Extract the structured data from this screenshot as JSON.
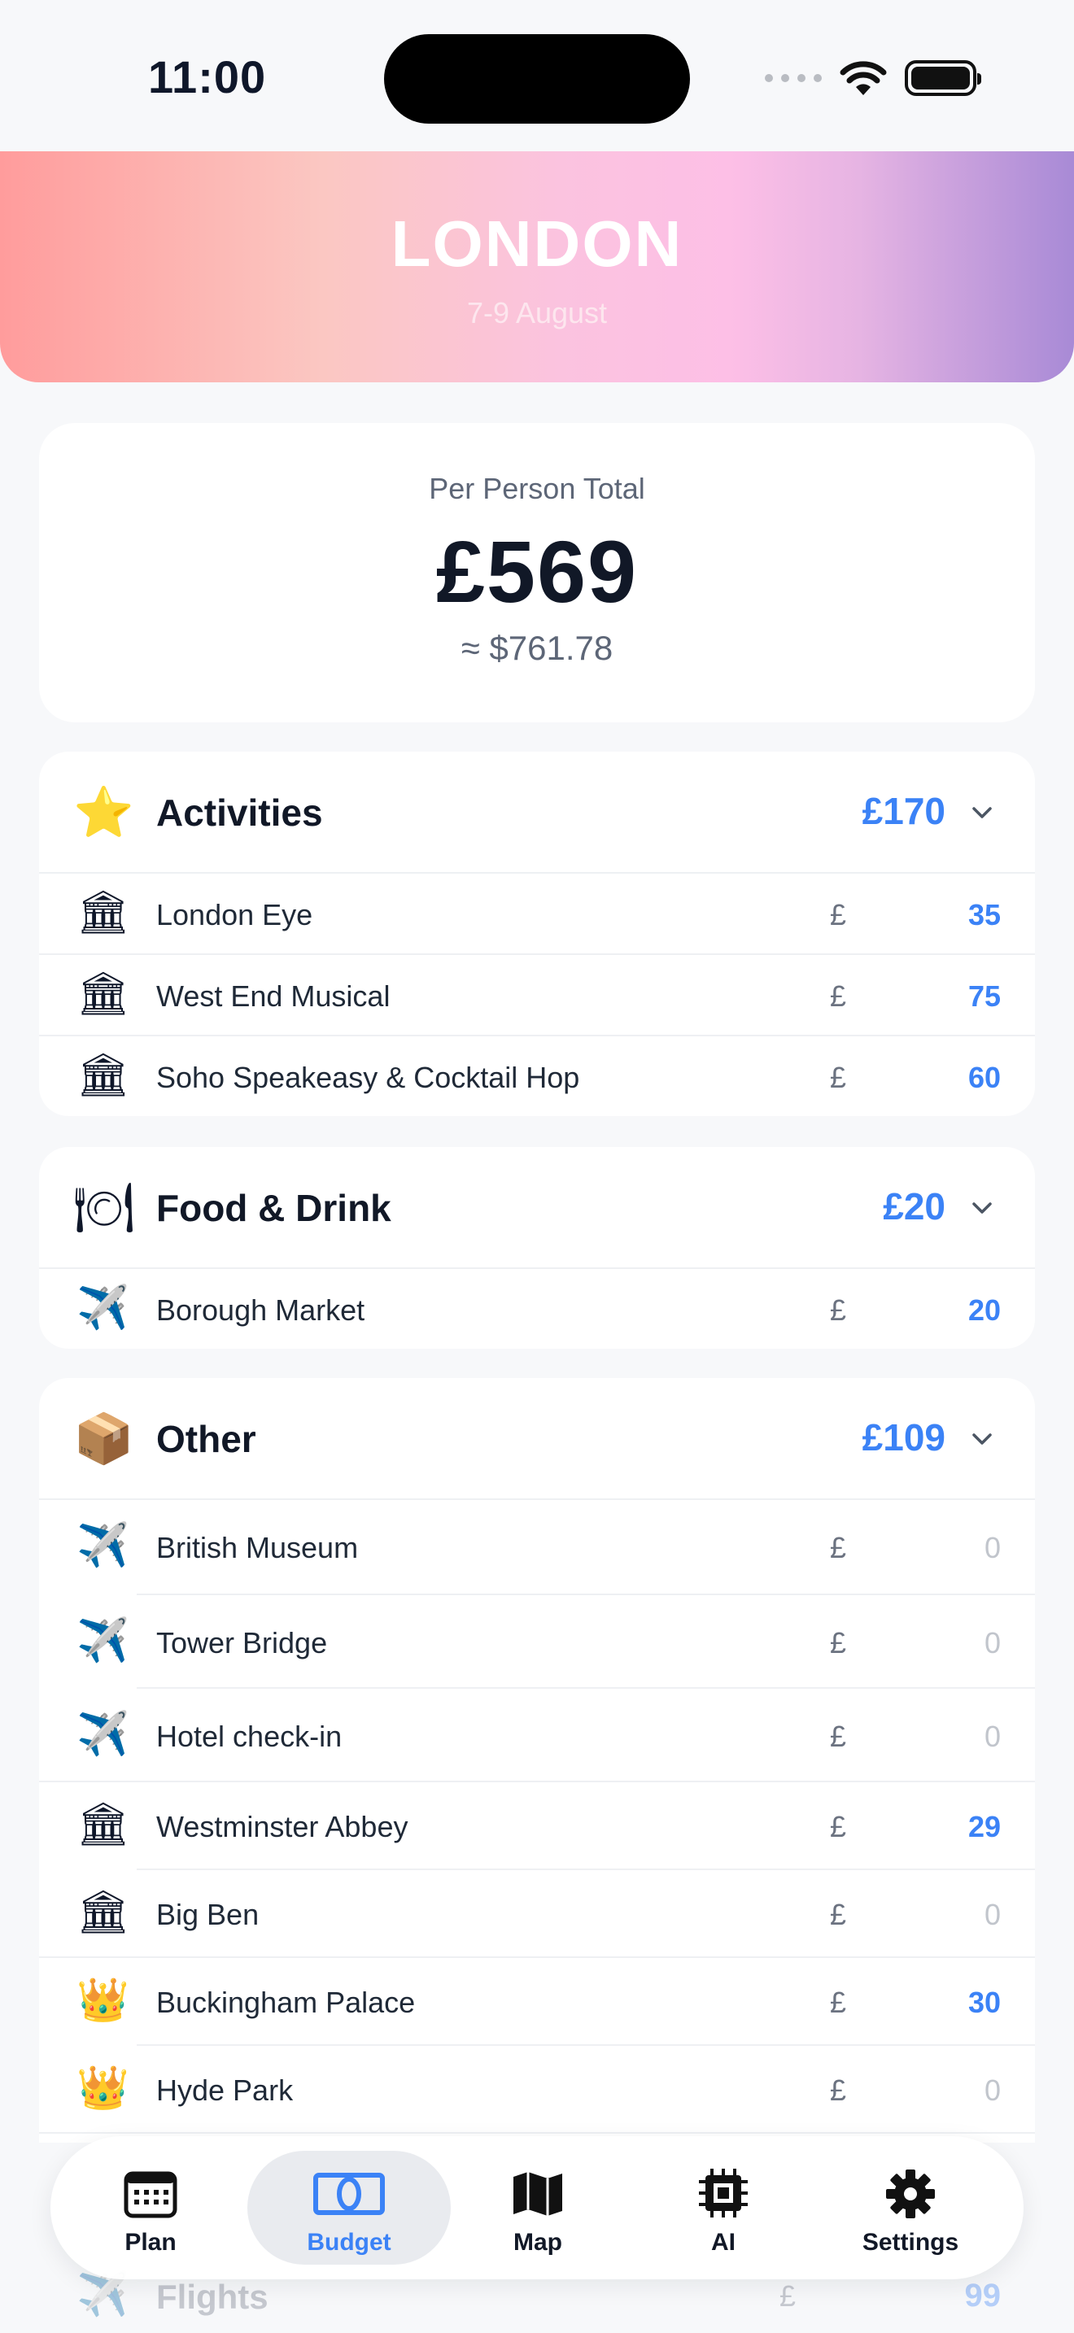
{
  "status": {
    "time": "11:00"
  },
  "header": {
    "title": "LONDON",
    "dates": "7-9 August"
  },
  "summary": {
    "label": "Per Person Total",
    "amount": "£569",
    "converted": "≈ $761.78"
  },
  "sections": [
    {
      "title": "Activities",
      "icon": "⭐",
      "total": "£170",
      "items": [
        {
          "icon": "🏛",
          "name": "London Eye",
          "currency": "£",
          "amount": "35"
        },
        {
          "icon": "🏛",
          "name": "West End Musical",
          "currency": "£",
          "amount": "75"
        },
        {
          "icon": "🏛",
          "name": "Soho Speakeasy & Cocktail Hop",
          "currency": "£",
          "amount": "60"
        }
      ]
    },
    {
      "title": "Food & Drink",
      "icon": "🍽",
      "total": "£20",
      "items": [
        {
          "icon": "✈️",
          "name": "Borough Market",
          "currency": "£",
          "amount": "20"
        }
      ]
    },
    {
      "title": "Other",
      "icon": "📦",
      "total": "£109",
      "items": [
        {
          "icon": "✈️",
          "name": "British Museum",
          "currency": "£",
          "amount": "0"
        },
        {
          "icon": "✈️",
          "name": "Tower Bridge",
          "currency": "£",
          "amount": "0"
        },
        {
          "icon": "✈️",
          "name": "Hotel check-in",
          "currency": "£",
          "amount": "0"
        },
        {
          "icon": "🏛",
          "name": "Westminster Abbey",
          "currency": "£",
          "amount": "29"
        },
        {
          "icon": "🏛",
          "name": "Big Ben",
          "currency": "£",
          "amount": "0"
        },
        {
          "icon": "👑",
          "name": "Buckingham Palace",
          "currency": "£",
          "amount": "30"
        },
        {
          "icon": "👑",
          "name": "Hyde Park",
          "currency": "£",
          "amount": "0"
        }
      ]
    }
  ],
  "behind_tabbar": {
    "name": "Flights",
    "currency": "£",
    "amount": "99"
  },
  "tabs": [
    {
      "label": "Plan",
      "icon": "calendar-icon"
    },
    {
      "label": "Budget",
      "icon": "budget-icon"
    },
    {
      "label": "Map",
      "icon": "map-icon"
    },
    {
      "label": "AI",
      "icon": "chip-icon"
    },
    {
      "label": "Settings",
      "icon": "gear-icon"
    }
  ],
  "colors": {
    "accent": "#3b82f6",
    "zero": "#c1c5cc"
  }
}
